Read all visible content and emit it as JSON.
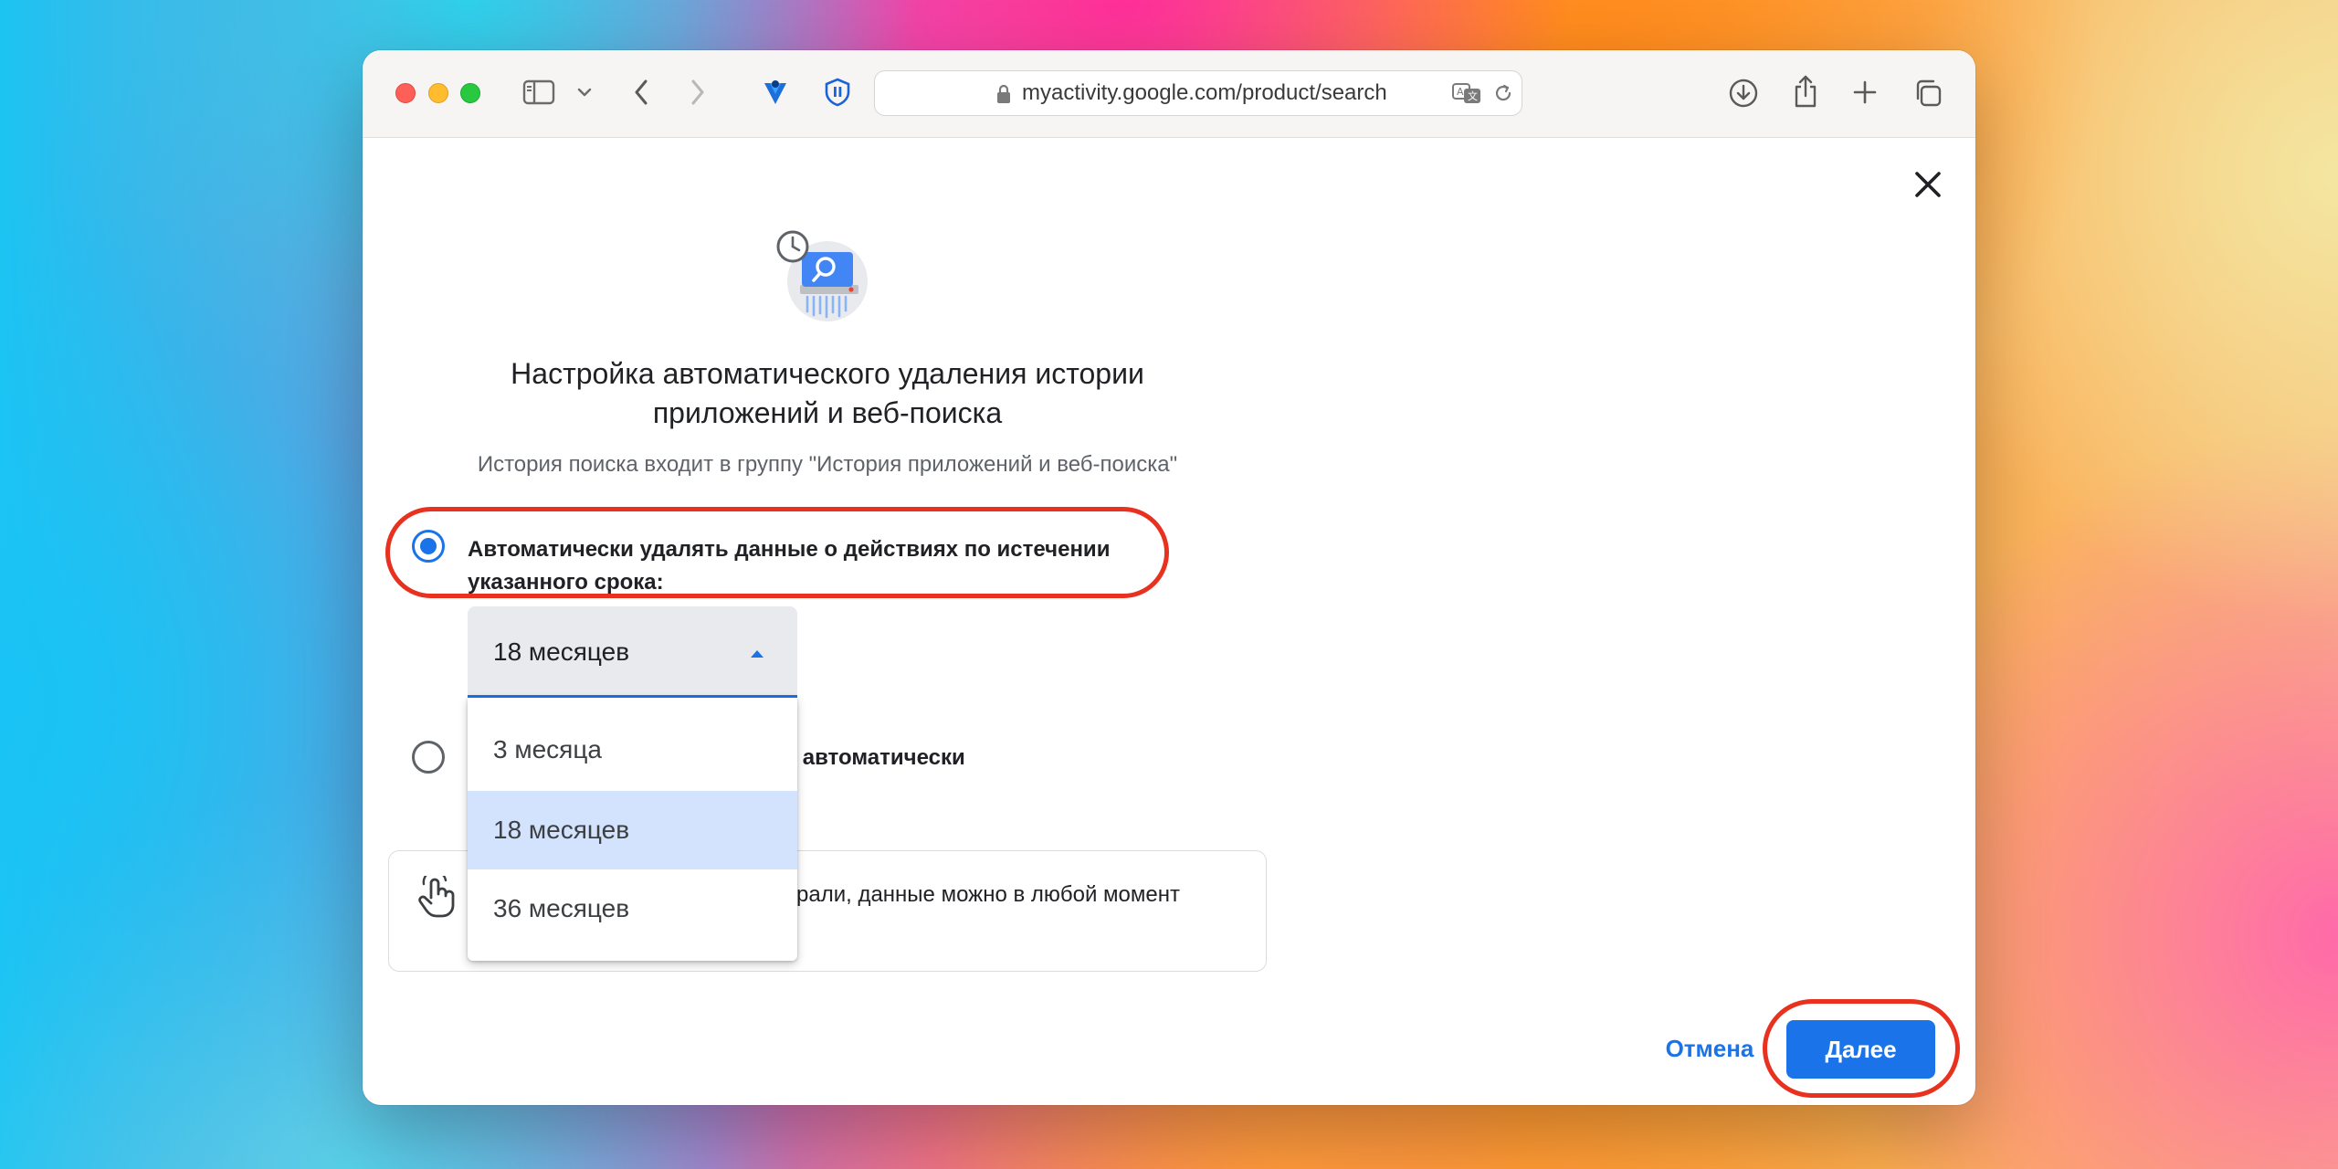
{
  "browser": {
    "url": "myactivity.google.com/product/search"
  },
  "dialog": {
    "title": "Настройка автоматического удаления истории приложений и веб-поиска",
    "subtitle": "История поиска входит в группу \"История приложений и веб-поиска\"",
    "options": [
      {
        "label": "Автоматически удалять данные о действиях по истечении указанного срока:",
        "selected": true
      },
      {
        "label": "иях автоматически",
        "selected": false
      }
    ],
    "period_select": {
      "value": "18 месяцев",
      "options": [
        "3 месяца",
        "18 месяцев",
        "36 месяцев"
      ],
      "highlighted": "18 месяцев"
    },
    "info_text": "рали, данные можно в любой момент",
    "cancel_label": "Отмена",
    "next_label": "Далее"
  },
  "colors": {
    "accent": "#1a73e8",
    "highlight_ring": "#e8311f",
    "dropdown_selected": "#d3e3fd"
  }
}
